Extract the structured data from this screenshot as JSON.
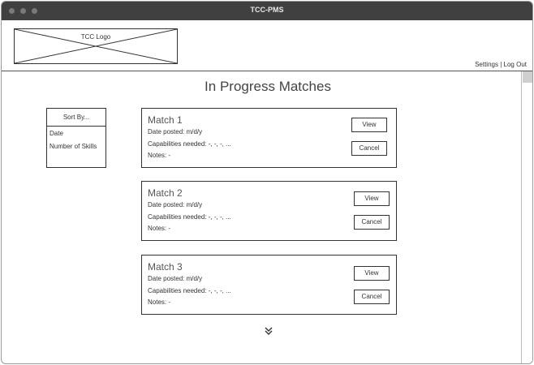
{
  "window": {
    "title": "TCC-PMS"
  },
  "header": {
    "logo_text": "TCC Logo",
    "links": {
      "settings": "Settings",
      "separator": "|",
      "logout": "Log Out"
    }
  },
  "page_title": "In Progress Matches",
  "sort": {
    "button_label": "Sort By...",
    "options": [
      "Date",
      "Number of Skills"
    ]
  },
  "matches": [
    {
      "title": "Match 1",
      "date": "Date posted: m/d/y",
      "capabilities": "Capabilities needed: -, -, -, ...",
      "notes": "Notes: -",
      "view_label": "View",
      "cancel_label": "Cancel"
    },
    {
      "title": "Match 2",
      "date": "Date posted: m/d/y",
      "capabilities": "Capabilities needed: -, -, -, ...",
      "notes": "Notes: -",
      "view_label": "View",
      "cancel_label": "Cancel"
    },
    {
      "title": "Match 3",
      "date": "Date posted: m/d/y",
      "capabilities": "Capabilities needed: -, -, -, ...",
      "notes": "Notes: -",
      "view_label": "View",
      "cancel_label": "Cancel"
    }
  ],
  "icons": {
    "more": "double-chevron-down-icon"
  }
}
